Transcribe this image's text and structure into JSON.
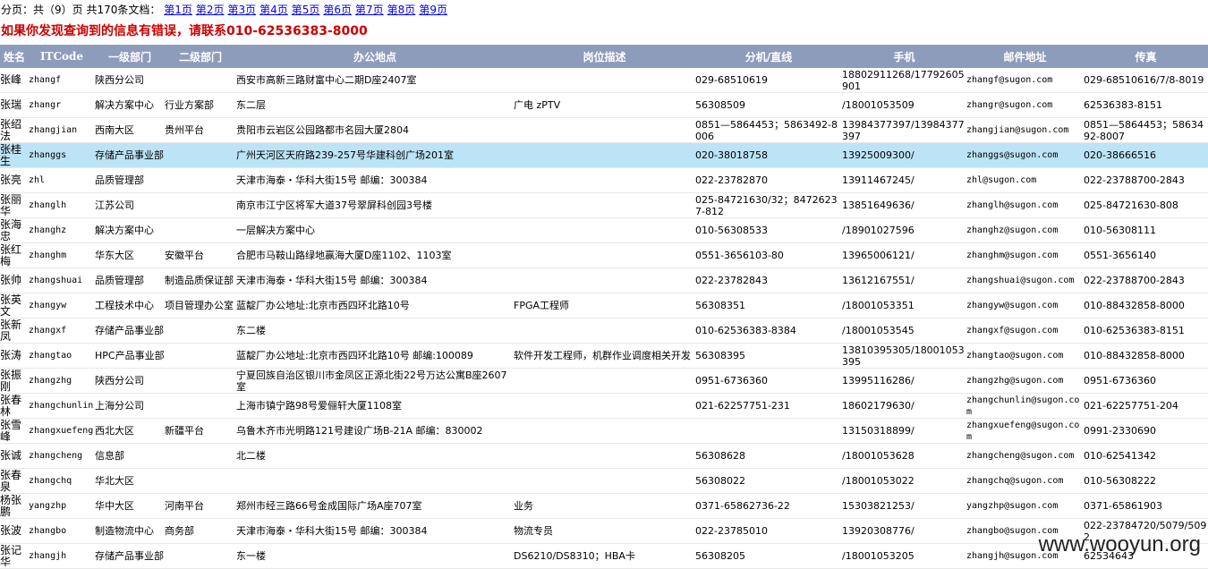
{
  "pager": {
    "summary": "分页：共（9）页 共170条文档：",
    "pages": [
      "第1页",
      "第2页",
      "第3页",
      "第4页",
      "第5页",
      "第6页",
      "第7页",
      "第8页",
      "第9页"
    ]
  },
  "notice": "如果你发现查询到的信息有错误，请联系010-62536383-8000",
  "table": {
    "headers": [
      "姓名",
      "ITCode",
      "一级部门",
      "二级部门",
      "办公地点",
      "岗位描述",
      "分机/直线",
      "手机",
      "邮件地址",
      "传真"
    ],
    "rows": [
      [
        "张峰",
        "zhangf",
        "陕西分公司",
        "",
        "西安市高新三路财富中心二期D座2407室",
        "",
        "029-68510619",
        "18802911268/17792605901",
        "zhangf@sugon.com",
        "029-68510616/7/8-8019"
      ],
      [
        "张瑞",
        "zhangr",
        "解决方案中心",
        "行业方案部",
        "东二层",
        "广电 zPTV",
        "56308509",
        "/18001053509",
        "zhangr@sugon.com",
        "62536383-8151"
      ],
      [
        "张绍法",
        "zhangjian",
        "西南大区",
        "贵州平台",
        "贵阳市云岩区公园路都市名园大厦2804",
        "",
        "0851—5864453；5863492-8006",
        "13984377397/13984377397",
        "zhangjian@sugon.com",
        "0851—5864453；5863492-8007"
      ],
      [
        "张桂生",
        "zhanggs",
        "存储产品事业部",
        "",
        "广州天河区天府路239-257号华建科创广场201室",
        "",
        "020-38018758",
        "13925009300/",
        "zhanggs@sugon.com",
        "020-38666516"
      ],
      [
        "张亮",
        "zhl",
        "品质管理部",
        "",
        "天津市海泰・华科大街15号 邮编：300384",
        "",
        "022-23782870",
        "13911467245/",
        "zhl@sugon.com",
        "022-23788700-2843"
      ],
      [
        "张丽华",
        "zhanglh",
        "江苏公司",
        "",
        "南京市江宁区将军大道37号翠屏科创园3号楼",
        "",
        "025-84721630/32；84726237-812",
        "13851649636/",
        "zhanglh@sugon.com",
        "025-84721630-808"
      ],
      [
        "张海忠",
        "zhanghz",
        "解决方案中心",
        "",
        "一层解决方案中心",
        "",
        "010-56308533",
        "/18901027596",
        "zhanghz@sugon.com",
        "010-56308111"
      ],
      [
        "张红梅",
        "zhanghm",
        "华东大区",
        "安徽平台",
        "合肥市马鞍山路绿地赢海大厦D座1102、1103室",
        "",
        "0551-3656103-80",
        "13965006121/",
        "zhanghm@sugon.com",
        "0551-3656140"
      ],
      [
        "张帅",
        "zhangshuai",
        "品质管理部",
        "制造品质保证部",
        "天津市海泰・华科大街15号 邮编：300384",
        "",
        "022-23782843",
        "13612167551/",
        "zhangshuai@sugon.com",
        "022-23788700-2843"
      ],
      [
        "张英文",
        "zhangyw",
        "工程技术中心",
        "项目管理办公室",
        "蓝靛厂办公地址:北京市西四环北路10号",
        "FPGA工程师",
        "56308351",
        "/18001053351",
        "zhangyw@sugon.com",
        "010-88432858-8000"
      ],
      [
        "张新凤",
        "zhangxf",
        "存储产品事业部",
        "",
        "东二楼",
        "",
        "010-62536383-8384",
        "/18001053545",
        "zhangxf@sugon.com",
        "010-62536383-8151"
      ],
      [
        "张涛",
        "zhangtao",
        "HPC产品事业部",
        "",
        "蓝靛厂办公地址:北京市西四环北路10号 邮编:100089",
        "软件开发工程师，机群作业调度相关开发",
        "56308395",
        "13810395305/18001053395",
        "zhangtao@sugon.com",
        "010-88432858-8000"
      ],
      [
        "张振刚",
        "zhangzhg",
        "陕西分公司",
        "",
        "宁夏回族自治区银川市金凤区正源北街22号万达公寓B座2607室",
        "",
        "0951-6736360",
        "13995116286/",
        "zhangzhg@sugon.com",
        "0951-6736360"
      ],
      [
        "张春林",
        "zhangchunlin",
        "上海分公司",
        "",
        "上海市镇宁路98号爱俪轩大厦1108室",
        "",
        "021-62257751-231",
        "18602179630/",
        "zhangchunlin@sugon.com",
        "021-62257751-204"
      ],
      [
        "张雪峰",
        "zhangxuefeng",
        "西北大区",
        "新疆平台",
        "乌鲁木齐市光明路121号建设广场B-21A 邮编：830002",
        "",
        "",
        "13150318899/",
        "zhangxuefeng@sugon.com",
        "0991-2330690"
      ],
      [
        "张诚",
        "zhangcheng",
        "信息部",
        "",
        "北二楼",
        "",
        "56308628",
        "/18001053628",
        "zhangcheng@sugon.com",
        "010-62541342"
      ],
      [
        "张春泉",
        "zhangchq",
        "华北大区",
        "",
        "",
        "",
        "56308022",
        "/18001053022",
        "zhangchq@sugon.com",
        "010-56308222"
      ],
      [
        "杨张鹏",
        "yangzhp",
        "华中大区",
        "河南平台",
        "郑州市经三路66号金成国际广场A座707室",
        "业务",
        "0371-65862736-22",
        "15303821253/",
        "yangzhp@sugon.com",
        "0371-65861903"
      ],
      [
        "张波",
        "zhangbo",
        "制造物流中心",
        "商务部",
        "天津市海泰・华科大街15号 邮编：300384",
        "物流专员",
        "022-23785010",
        "13920308776/",
        "zhangbo@sugon.com",
        "022-23784720/5079/5092"
      ],
      [
        "张记华",
        "zhangjh",
        "存储产品事业部",
        "",
        "东一楼",
        "DS6210/DS8310；HBA卡",
        "56308205",
        "/18001053205",
        "zhangjh@sugon.com",
        "62534643"
      ]
    ],
    "highlight_row_index": 3,
    "colors": {
      "header_bg": "#8e9cbc",
      "highlight_bg": "#bde3f7",
      "notice": "#cc0000",
      "link": "#0000ee"
    }
  },
  "watermark": "www.wooyun.org"
}
